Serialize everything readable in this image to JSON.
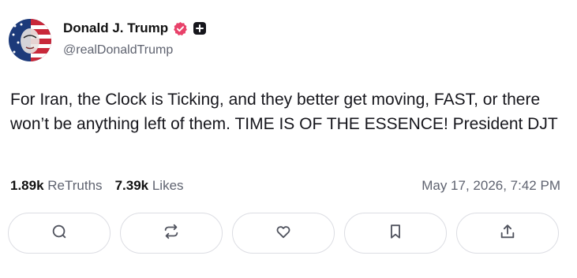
{
  "author": {
    "name": "Donald J. Trump",
    "handle": "@realDonaldTrump"
  },
  "post": {
    "text": "For Iran, the Clock is Ticking, and they better get moving, FAST, or there won’t be anything left of them. TIME IS OF THE ESSENCE! President DJT"
  },
  "stats": {
    "retruths_count": "1.89k",
    "retruths_label": "ReTruths",
    "likes_count": "7.39k",
    "likes_label": "Likes",
    "timestamp": "May 17, 2026, 7:42 PM"
  },
  "actions": [
    {
      "icon": "reply-icon"
    },
    {
      "icon": "retruth-icon"
    },
    {
      "icon": "like-icon"
    },
    {
      "icon": "bookmark-icon"
    },
    {
      "icon": "share-icon"
    }
  ],
  "colors": {
    "verified_badge": "#e8426a",
    "text": "#16161c",
    "muted": "#5f6370",
    "border": "#dcdde3"
  }
}
